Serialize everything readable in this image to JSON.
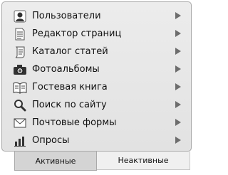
{
  "menu": {
    "items": [
      {
        "label": "Пользователи",
        "icon": "users-icon"
      },
      {
        "label": "Редактор страниц",
        "icon": "page-editor-icon"
      },
      {
        "label": "Каталог статей",
        "icon": "articles-catalog-icon"
      },
      {
        "label": "Фотоальбомы",
        "icon": "camera-icon"
      },
      {
        "label": "Гостевая книга",
        "icon": "guestbook-icon"
      },
      {
        "label": "Поиск по сайту",
        "icon": "search-icon"
      },
      {
        "label": "Почтовые формы",
        "icon": "mail-icon"
      },
      {
        "label": "Опросы",
        "icon": "poll-chart-icon"
      }
    ]
  },
  "tabs": {
    "active_label": "Активные",
    "inactive_label": "Неактивные"
  }
}
